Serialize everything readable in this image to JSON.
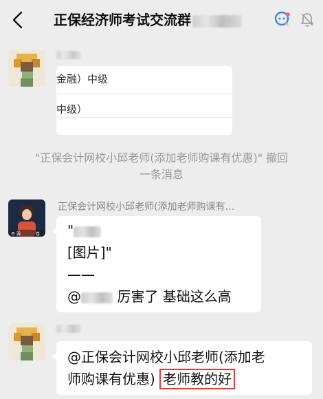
{
  "header": {
    "title": "正保经济师考试交流群",
    "back_icon": "chevron-left-icon",
    "group_icon": "group-chat-icon",
    "mute_icon": "bell-off-icon"
  },
  "messages": {
    "m1_card": {
      "line1": "金融）中级",
      "line2": "中级）"
    },
    "recall": {
      "line1": "\"正保会计网校小邱老师(添加老师购课有优惠)\" 撤回",
      "line2": "一条消息"
    },
    "m2": {
      "sender": "正保会计网校小邱老师(添加老师购课有…",
      "quote_open": "\"",
      "line_image": "[图片]\"",
      "divider": "——",
      "mention_at": "@",
      "reply": "厉害了 基础这么高"
    },
    "m3": {
      "line1": "@正保会计网校小邱老师(添加老",
      "line2_prefix": "师购课有优惠)",
      "highlight": "老师教的好"
    }
  },
  "colors": {
    "background": "#EDEDED",
    "bubble": "#FFFFFF",
    "highlight_border": "#E53935",
    "system_text": "#999999"
  }
}
